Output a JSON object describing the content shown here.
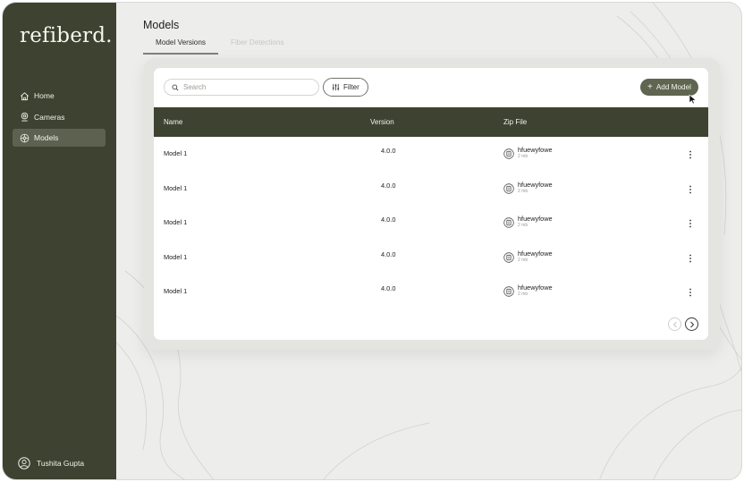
{
  "app": {
    "logo": "refiberd."
  },
  "sidebar": {
    "items": [
      {
        "label": "Home",
        "icon": "home-icon"
      },
      {
        "label": "Cameras",
        "icon": "camera-icon"
      },
      {
        "label": "Models",
        "icon": "models-icon",
        "active": true
      }
    ],
    "user": {
      "name": "Tushita Gupta",
      "icon": "user-avatar-icon"
    }
  },
  "header": {
    "title": "Models",
    "tabs": [
      {
        "label": "Model Versions",
        "active": true
      },
      {
        "label": "Fiber Detections",
        "active": false
      }
    ]
  },
  "toolbar": {
    "search_placeholder": "Search",
    "filter_label": "Filter",
    "add_label": "Add Model"
  },
  "table": {
    "columns": [
      "Name",
      "Version",
      "Zip File"
    ],
    "rows": [
      {
        "name": "Model 1",
        "version": "4.0.0",
        "zip_name": "hfuewyfowe",
        "zip_size": "2 mb"
      },
      {
        "name": "Model 1",
        "version": "4.0.0",
        "zip_name": "hfuewyfowe",
        "zip_size": "2 mb"
      },
      {
        "name": "Model 1",
        "version": "4.0.0",
        "zip_name": "hfuewyfowe",
        "zip_size": "2 mb"
      },
      {
        "name": "Model 1",
        "version": "4.0.0",
        "zip_name": "hfuewyfowe",
        "zip_size": "2 mb"
      },
      {
        "name": "Model 1",
        "version": "4.0.0",
        "zip_name": "hfuewyfowe",
        "zip_size": "2 mb"
      }
    ]
  },
  "colors": {
    "sidebar": "#3e4230",
    "accent": "#5f6551",
    "background": "#ededeb"
  }
}
